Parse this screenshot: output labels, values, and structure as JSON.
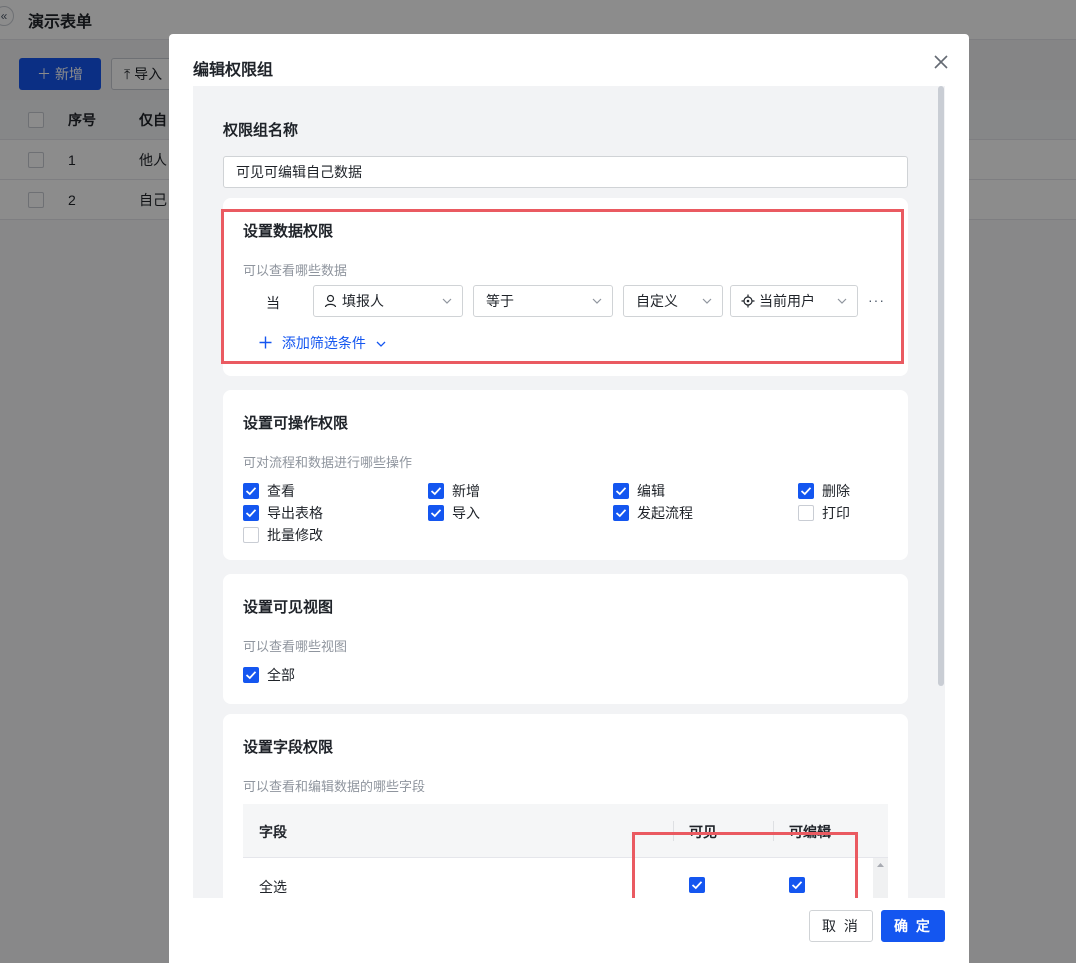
{
  "background": {
    "title": "演示表单",
    "back_icon": "double-chevron-left-icon",
    "add_button": "新增",
    "import_button": "导入",
    "table": {
      "headers": [
        "序号",
        "仅自"
      ],
      "rows": [
        {
          "index": "1",
          "text": "他人"
        },
        {
          "index": "2",
          "text": "自己"
        }
      ]
    }
  },
  "modal": {
    "title": "编辑权限组",
    "close_icon": "close-icon",
    "group_name_label": "权限组名称",
    "group_name_value": "可见可编辑自己数据",
    "data_permission": {
      "title": "设置数据权限",
      "desc": "可以查看哪些数据",
      "when_label": "当",
      "field_select": "填报人",
      "field_icon": "person-icon",
      "operator_select": "等于",
      "value_type_select": "自定义",
      "value_select": "当前用户",
      "value_icon": "locate-icon",
      "more": "···",
      "add_filter": "添加筛选条件"
    },
    "operation_permission": {
      "title": "设置可操作权限",
      "desc": "可对流程和数据进行哪些操作",
      "items": [
        {
          "label": "查看",
          "checked": true
        },
        {
          "label": "新增",
          "checked": true
        },
        {
          "label": "编辑",
          "checked": true
        },
        {
          "label": "删除",
          "checked": true
        },
        {
          "label": "导出表格",
          "checked": true
        },
        {
          "label": "导入",
          "checked": true
        },
        {
          "label": "发起流程",
          "checked": true
        },
        {
          "label": "打印",
          "checked": false
        },
        {
          "label": "批量修改",
          "checked": false
        }
      ]
    },
    "view_permission": {
      "title": "设置可见视图",
      "desc": "可以查看哪些视图",
      "items": [
        {
          "label": "全部",
          "checked": true
        }
      ]
    },
    "field_permission": {
      "title": "设置字段权限",
      "desc": "可以查看和编辑数据的哪些字段",
      "columns": [
        "字段",
        "可见",
        "可编辑"
      ],
      "rows": [
        {
          "field": "全选",
          "visible": true,
          "editable": true
        }
      ]
    },
    "cancel_button": "取 消",
    "ok_button": "确 定"
  },
  "colors": {
    "primary": "#1456f0",
    "highlight_border": "#ea5a61",
    "overlay": "rgba(0,0,0,0.45)"
  }
}
